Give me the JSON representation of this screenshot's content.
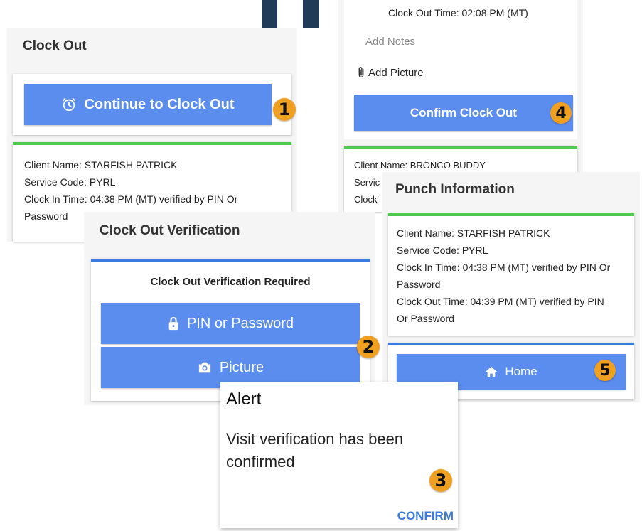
{
  "decor": {
    "logo_color": "#1f3b57"
  },
  "colors": {
    "accent": "#5b8def",
    "success_bar": "#4fc94f",
    "info_bar": "#3a7be0",
    "badge": "#f0a020",
    "link": "#3a7be0"
  },
  "clock_out_panel": {
    "title": "Clock Out",
    "continue_button": "Continue to Clock Out",
    "badge": "1",
    "client_name": "Client Name: STARFISH PATRICK",
    "service_code": "Service Code: PYRL",
    "clock_in_line1": "Clock In Time: 04:38 PM (MT) verified by PIN Or",
    "clock_in_line2": "Password"
  },
  "confirm_panel": {
    "clock_out_time": "Clock Out Time: 02:08 PM (MT)",
    "notes_placeholder": "Add Notes",
    "add_picture": "Add Picture",
    "confirm_button": "Confirm Clock Out",
    "badge": "4",
    "client_name": "Client Name: BRONCO BUDDY",
    "service_partial": "Servic",
    "clock_partial": "Clock"
  },
  "verification_panel": {
    "title": "Clock Out Verification",
    "heading": "Clock Out Verification Required",
    "pin_button": "PIN or Password",
    "picture_button": "Picture",
    "badge": "2"
  },
  "alert_dialog": {
    "title": "Alert",
    "message_line1": "Visit verification has been",
    "message_line2": "confirmed",
    "confirm": "CONFIRM",
    "badge": "3"
  },
  "punch_panel": {
    "title": "Punch Information",
    "client_name": "Client Name: STARFISH PATRICK",
    "service_code": "Service Code: PYRL",
    "clock_in_line1": "Clock In Time: 04:38 PM (MT) verified by PIN Or",
    "clock_in_line2": "Password",
    "clock_out_line1": "Clock Out Time: 04:39 PM (MT) verified by PIN",
    "clock_out_line2": "Or Password",
    "home_button": "Home",
    "badge": "5"
  }
}
